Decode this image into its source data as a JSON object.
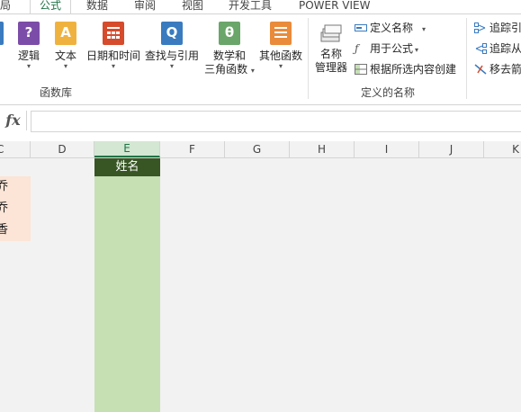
{
  "tabs": [
    "局",
    "公式",
    "数据",
    "审阅",
    "视图",
    "开发工具",
    "POWER VIEW"
  ],
  "ribbon": {
    "buttons": [
      {
        "label": "逻辑",
        "icon": "logic-icon",
        "color": "#7c4da8",
        "glyph": "?"
      },
      {
        "label": "文本",
        "icon": "text-icon",
        "color": "#f0b23f",
        "glyph": "A"
      },
      {
        "label": "日期和时间",
        "icon": "date-time-icon",
        "color": "#d64b2b",
        "glyph": ""
      },
      {
        "label": "查找与引用",
        "icon": "lookup-icon",
        "color": "#3a7bbf",
        "glyph": "Q"
      },
      {
        "label_line1": "数学和",
        "label_line2": "三角函数",
        "icon": "math-icon",
        "color": "#6aa56a",
        "glyph": "θ"
      },
      {
        "label": "其他函数",
        "icon": "more-functions-icon",
        "color": "#e98b3a",
        "glyph": ""
      }
    ],
    "group_function_library": "函数库",
    "name_manager": {
      "line1": "名称",
      "line2": "管理器"
    },
    "define_name": "定义名称",
    "use_in_formula": "用于公式",
    "create_from_selection": "根据所选内容创建",
    "group_defined_names": "定义的名称",
    "trace_precedents": "追踪引",
    "trace_dependents": "追踪从",
    "remove_arrows": "移去箭"
  },
  "formula_bar": {
    "fx": "fx",
    "value": ""
  },
  "columns": [
    "C",
    "D",
    "E",
    "F",
    "G",
    "H",
    "I",
    "J",
    "K"
  ],
  "cells_c": [
    "乔",
    "乔",
    "香"
  ],
  "header_e": "姓名",
  "colors": {
    "accent": "#217346",
    "header_dark_green": "#375623",
    "light_green": "#c6e0b4",
    "peach": "#fce4d6"
  }
}
